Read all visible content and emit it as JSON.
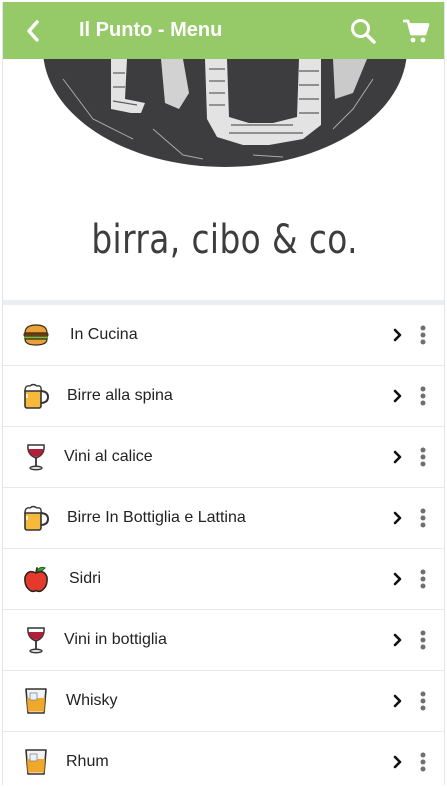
{
  "header": {
    "title": "Il Punto - Menu",
    "back_icon": "chevron-left-icon",
    "search_icon": "search-icon",
    "cart_icon": "cart-icon",
    "bar_color": "#96c967"
  },
  "hero": {
    "tagline": "birra, cibo & co."
  },
  "menu": {
    "items": [
      {
        "label": "In Cucina",
        "icon": "burger-icon"
      },
      {
        "label": "Birre alla spina",
        "icon": "beer-mug-icon"
      },
      {
        "label": "Vini al calice",
        "icon": "wine-glass-icon"
      },
      {
        "label": "Birre In Bottiglia e Lattina",
        "icon": "beer-mug-icon"
      },
      {
        "label": "Sidri",
        "icon": "apple-icon"
      },
      {
        "label": "Vini in bottiglia",
        "icon": "wine-glass-icon"
      },
      {
        "label": "Whisky",
        "icon": "tumbler-glass-icon"
      },
      {
        "label": "Rhum",
        "icon": "tumbler-glass-icon"
      }
    ]
  }
}
